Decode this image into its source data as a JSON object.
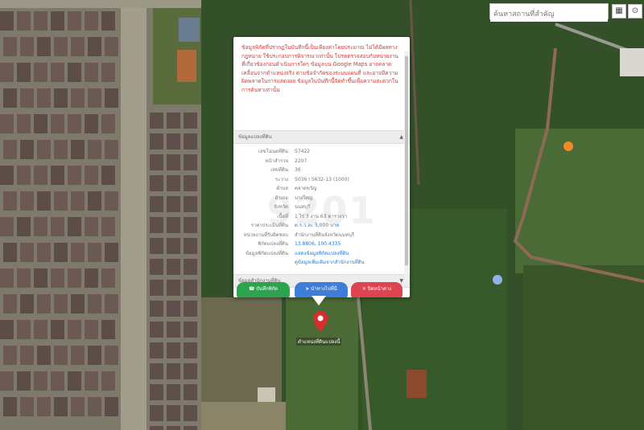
{
  "search": {
    "placeholder": "ค้นหาสถานที่สำคัญ"
  },
  "controls": {
    "layers_icon": "grid-icon",
    "locate_icon": "marker-icon"
  },
  "popup": {
    "disclaimer": "ข้อมูลพิกัดที่ปรากฏในบันทึกนี้เป็นเพียงค่าโดยประมาณ ไม่ได้มีผลทางกฎหมาย ใช้ประกอบการพิจารณาเท่านั้น โปรดตรวจสอบกับหน่วยงานที่เกี่ยวข้องก่อนดำเนินการใดๆ ข้อมูลบน Google Maps อาจคลาดเคลื่อนจากตำแหน่งจริง ตามข้อจำกัดของระบบแผนที่ และอาจมีความผิดพลาดในการแสดงผล ข้อมูลในบันทึกนี้จัดทำขึ้นเพื่อความสะดวกในการค้นหาเท่านั้น",
    "section_parcel": "ข้อมูลแปลงที่ดิน",
    "rows": [
      {
        "k": "เลขโฉนดที่ดิน",
        "v": "57422"
      },
      {
        "k": "หน้าสำรวจ",
        "v": "2207"
      },
      {
        "k": "เลขที่ดิน",
        "v": "36"
      },
      {
        "k": "ระวาง",
        "v": "5036 I 5632-13 (1000)"
      },
      {
        "k": "ตำบล",
        "v": "ตลาดขวัญ"
      },
      {
        "k": "อำเภอ",
        "v": "บางใหญ่"
      },
      {
        "k": "จังหวัด",
        "v": "นนทบุรี"
      },
      {
        "k": "เนื้อที่",
        "v": "1 ไร่ 3 งาน 63 ตารางวา"
      },
      {
        "k": "ราคาประเมินที่ดิน",
        "v": "ต.ร.ว.ละ 5,000 บาท",
        "link": true
      },
      {
        "k": "หน่วยงานที่รับผิดชอบ",
        "v": "สำนักงานที่ดินจังหวัดนนทบุรี"
      },
      {
        "k": "พิกัดแปลงที่ดิน",
        "v": "13.8806, 100.4335",
        "link": true
      },
      {
        "k": "ข้อมูลพิกัดแปลงที่ดิน",
        "v": "แสดงข้อมูลพิกัดแปลงที่ดิน",
        "link": true
      },
      {
        "k": "",
        "v": "ดูข้อมูลเพิ่มเติมจากสำนักงานที่ดิน",
        "link": true
      }
    ],
    "watermark": "9201",
    "section_other": "ข้อมูลสำนักงานที่ดิน",
    "btn_green": "บันทึกพิกัด",
    "btn_blue": "นำทางไปที่นี่",
    "btn_red": "ปิดหน้าต่าง"
  },
  "marker_label": "ตำแหน่งที่ดินแปลงนี้",
  "colors": {
    "pin": "#d92d2d",
    "disclaimer": "#d23b3b",
    "link": "#2a7ad0"
  }
}
